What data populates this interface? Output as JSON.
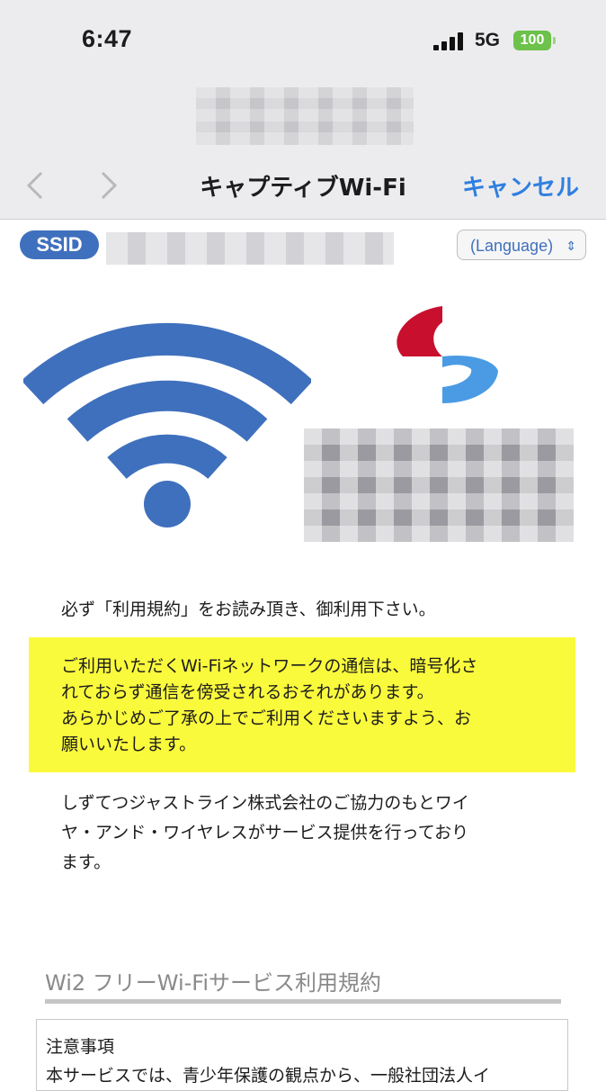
{
  "status_bar": {
    "time": "6:47",
    "network": "5G",
    "battery": "100"
  },
  "sheet": {
    "title": "キャプティブWi-Fi",
    "cancel_label": "キャンセル"
  },
  "ssid": {
    "badge_label": "SSID"
  },
  "language_select": {
    "selected": "(Language)"
  },
  "content": {
    "notice": "必ず「利用規約」をお読み頂き、御利用下さい。",
    "warning_lines": [
      "ご利用いただくWi-Fiネットワークの通信は、暗号化さ",
      "れておらず通信を傍受されるおそれがあります。",
      "あらかじめご了承の上でご利用くださいますよう、お",
      "願いいたします。"
    ],
    "partner_lines": [
      "しずてつジャストライン株式会社のご協力のもとワイ",
      "ヤ・アンド・ワイヤレスがサービス提供を行っており",
      "ます。"
    ],
    "terms_title": "Wi2 フリーWi-Fiサービス利用規約",
    "terms_box": {
      "heading": "注意事項",
      "first_line": "本サービスでは、青少年保護の観点から、一般社団法人イ"
    }
  },
  "colors": {
    "accent": "#2f7fe0",
    "ssid_badge": "#3f70bd",
    "wifi_icon": "#3f70bd",
    "warning_bg": "#fafa3c",
    "battery": "#6cc24a",
    "logo_red": "#c8102e",
    "logo_blue": "#4a9be3"
  },
  "icons": [
    "lock-icon",
    "back-chevron-icon",
    "forward-chevron-icon",
    "wifi-icon",
    "updown-chevron-icon"
  ]
}
